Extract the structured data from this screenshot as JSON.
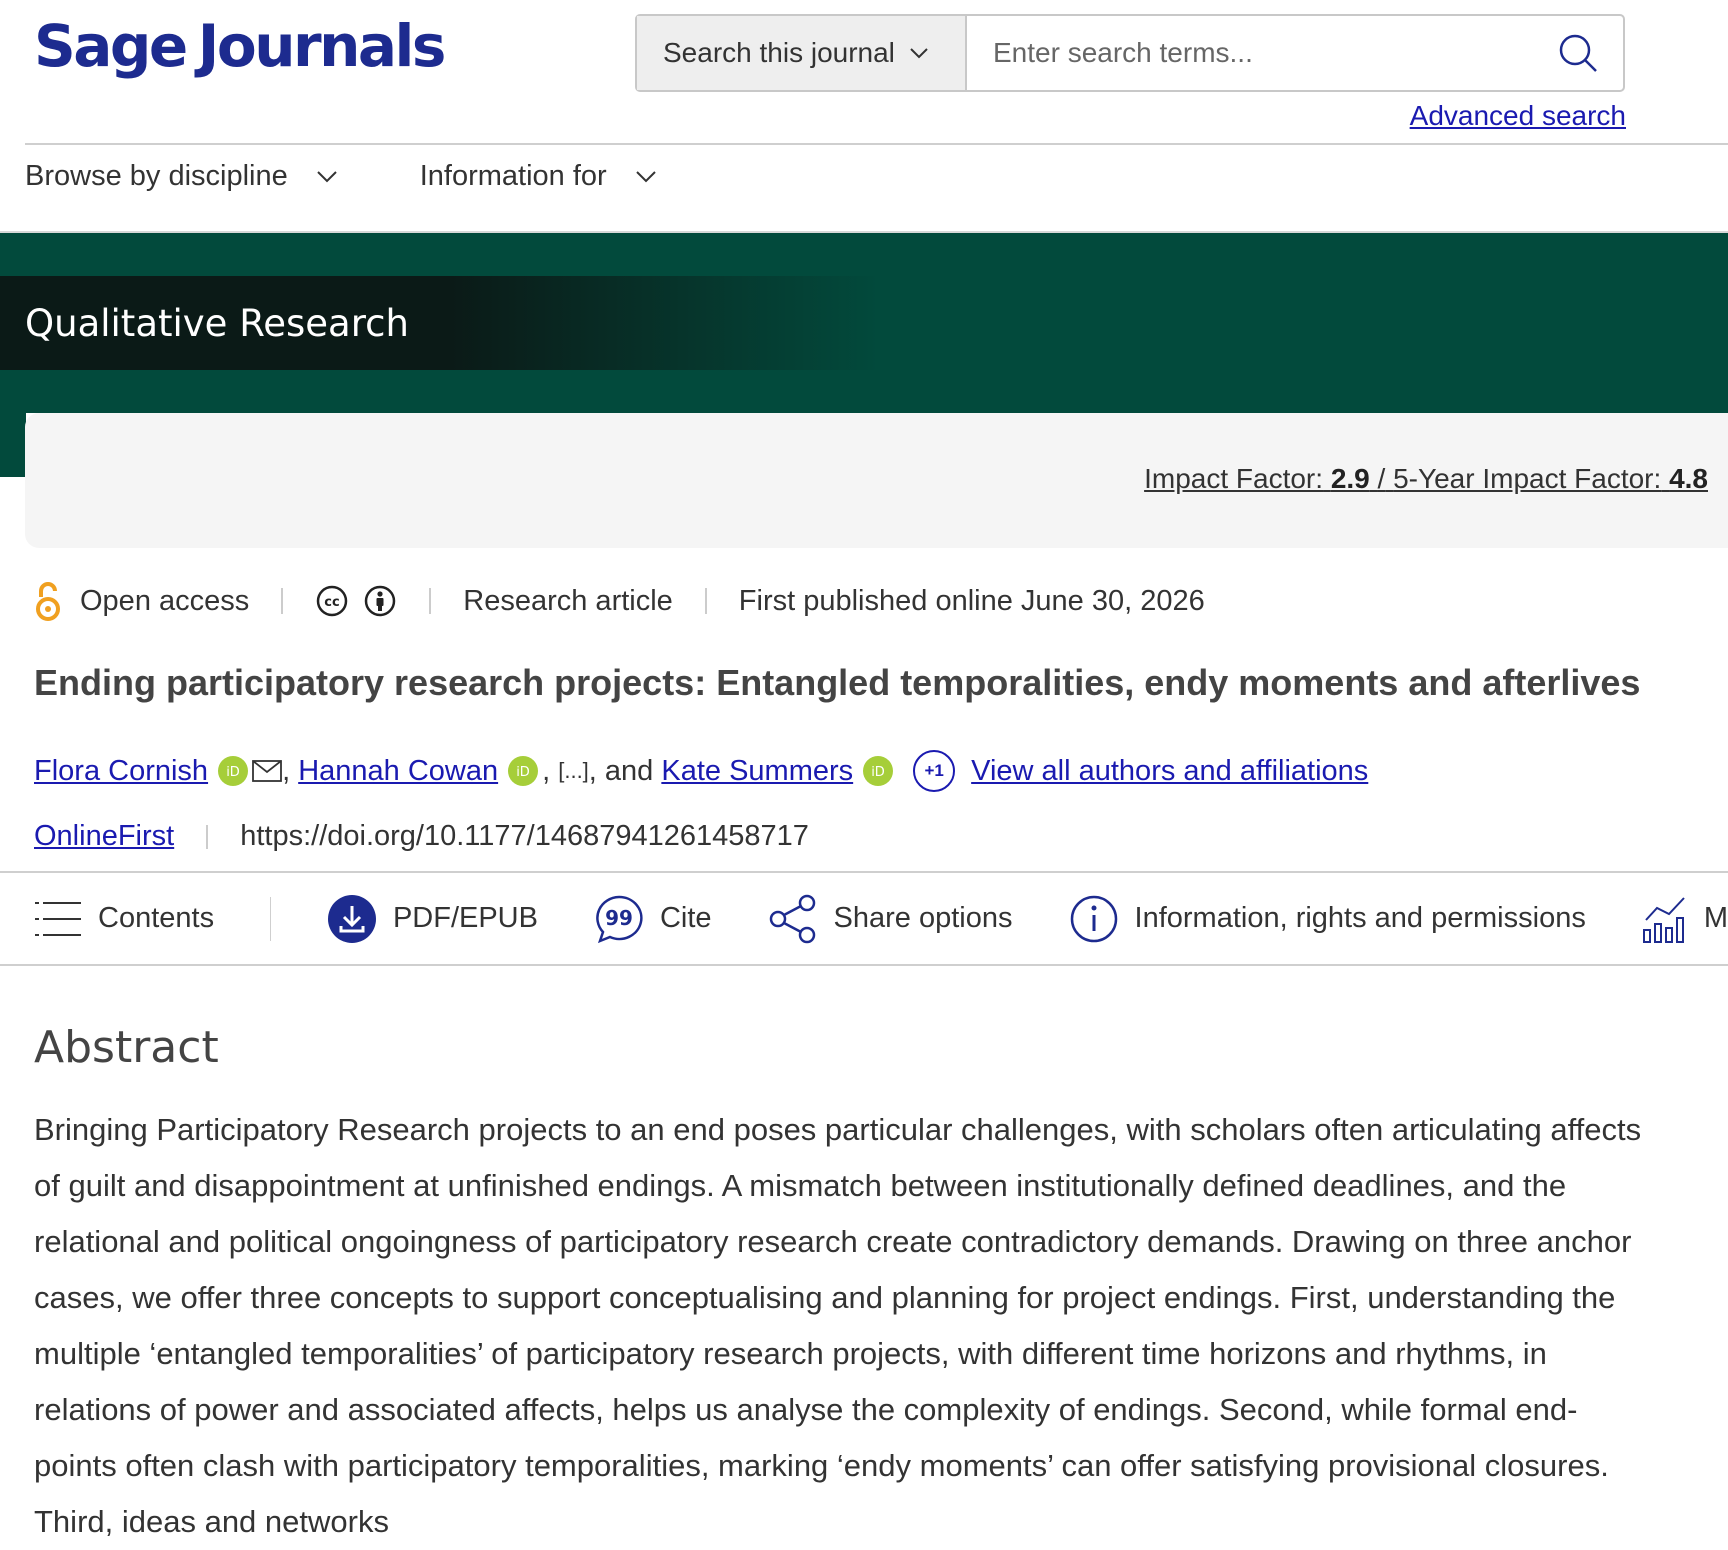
{
  "header": {
    "logo": {
      "word1": "Sage",
      "word2": "Journals"
    },
    "search_scope": "Search this journal",
    "search_placeholder": "Enter search terms...",
    "advanced_search": "Advanced search"
  },
  "nav": [
    {
      "label": "Browse by discipline"
    },
    {
      "label": "Information for"
    }
  ],
  "journal": {
    "title": "Qualitative Research",
    "impact_label": "Impact Factor:",
    "impact_value": "2.9",
    "impact_sep": "/",
    "five_year_label": "5-Year Impact Factor:",
    "five_year_value": "4.8"
  },
  "article": {
    "access": "Open access",
    "type": "Research article",
    "published": "First published online June 30, 2026",
    "title": "Ending participatory research projects: Entangled temporalities, endy moments and afterlives",
    "authors": [
      "Flora Cornish",
      "Hannah Cowan",
      "Kate Summers"
    ],
    "author_sep": ",",
    "ellipsis": "[...]",
    "and": ", and",
    "extra_authors": "+1",
    "view_all": "View all authors and affiliations",
    "status": "OnlineFirst",
    "doi": "https://doi.org/10.1177/14687941261458717"
  },
  "toolbar": {
    "contents": "Contents",
    "pdf": "PDF/EPUB",
    "cite": "Cite",
    "share": "Share options",
    "info": "Information, rights and permissions",
    "metrics": "M"
  },
  "abstract": {
    "heading": "Abstract",
    "text": "Bringing Participatory Research projects to an end poses particular challenges, with scholars often articulating affects of guilt and disappointment at unfinished endings. A mismatch between institutionally defined deadlines, and the relational and political ongoingness of participatory research create contradictory demands. Drawing on three anchor cases, we offer three concepts to support conceptualising and planning for project endings. First, understanding the multiple ‘entangled temporalities’ of participatory research projects, with different time horizons and rhythms, in relations of power and associated affects, helps us analyse the complexity of endings. Second, while formal end-points often clash with participatory temporalities, marking ‘endy moments’ can offer satisfying provisional closures. Third, ideas and networks"
  },
  "colors": {
    "brand": "#1d2b8f",
    "banner": "#024a3c",
    "link": "#1a1ab0",
    "open_access": "#f0a020",
    "orcid": "#a6ce39"
  }
}
